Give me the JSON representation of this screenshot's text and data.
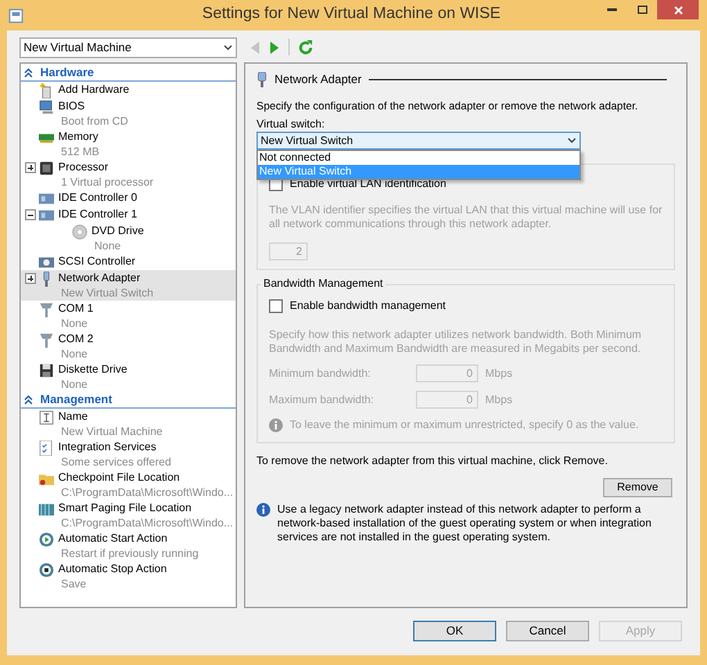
{
  "window": {
    "title": "Settings for New Virtual Machine on WISE"
  },
  "vm_selector": {
    "value": "New Virtual Machine"
  },
  "toolbar": {
    "back": {
      "disabled": true
    },
    "forward": {
      "disabled": false
    }
  },
  "tree": [
    {
      "heading": "Hardware",
      "expanded": true,
      "items": [
        {
          "label": "Add Hardware",
          "selected": false
        },
        {
          "label": "BIOS",
          "detail": "Boot from CD",
          "selected": false
        },
        {
          "label": "Memory",
          "detail": "512 MB",
          "selected": false
        },
        {
          "label": "Processor",
          "detail": "1 Virtual processor",
          "expanded": false,
          "selected": false
        },
        {
          "label": "IDE Controller 0",
          "selected": false
        },
        {
          "label": "IDE Controller 1",
          "expanded": true,
          "selected": false,
          "children": [
            {
              "label": "DVD Drive",
              "detail": "None",
              "selected": false
            }
          ]
        },
        {
          "label": "SCSI Controller",
          "selected": false
        },
        {
          "label": "Network Adapter",
          "detail": "New Virtual Switch",
          "expanded": false,
          "selected": true
        },
        {
          "label": "COM 1",
          "detail": "None",
          "selected": false
        },
        {
          "label": "COM 2",
          "detail": "None",
          "selected": false
        },
        {
          "label": "Diskette Drive",
          "detail": "None",
          "selected": false
        }
      ]
    },
    {
      "heading": "Management",
      "expanded": true,
      "items": [
        {
          "label": "Name",
          "detail": "New Virtual Machine",
          "selected": false
        },
        {
          "label": "Integration Services",
          "detail": "Some services offered",
          "selected": false
        },
        {
          "label": "Checkpoint File Location",
          "detail": "C:\\ProgramData\\Microsoft\\Windo...",
          "selected": false
        },
        {
          "label": "Smart Paging File Location",
          "detail": "C:\\ProgramData\\Microsoft\\Windo...",
          "selected": false
        },
        {
          "label": "Automatic Start Action",
          "detail": "Restart if previously running",
          "selected": false
        },
        {
          "label": "Automatic Stop Action",
          "detail": "Save",
          "selected": false
        }
      ]
    }
  ],
  "panel": {
    "title": "Network Adapter",
    "description": "Specify the configuration of the network adapter or remove the network adapter.",
    "switch_label": "Virtual switch:",
    "switch": {
      "value": "New Virtual Switch",
      "open": true,
      "options": [
        {
          "label": "Not connected",
          "selected": false
        },
        {
          "label": "New Virtual Switch",
          "selected": true
        }
      ]
    },
    "vlan": {
      "checkbox": {
        "label": "Enable virtual LAN identification",
        "checked": false
      },
      "description": "The VLAN identifier specifies the virtual LAN that this virtual machine will use for all network communications through this network adapter.",
      "value": "2"
    },
    "bandwidth": {
      "title": "Bandwidth Management",
      "checkbox": {
        "label": "Enable bandwidth management",
        "checked": false
      },
      "description": "Specify how this network adapter utilizes network bandwidth. Both Minimum Bandwidth and Maximum Bandwidth are measured in Megabits per second.",
      "fields": [
        {
          "label": "Minimum bandwidth:",
          "value": "0",
          "unit": "Mbps"
        },
        {
          "label": "Maximum bandwidth:",
          "value": "0",
          "unit": "Mbps"
        }
      ],
      "note": "To leave the minimum or maximum unrestricted, specify 0 as the value."
    },
    "remove_text": "To remove the network adapter from this virtual machine, click Remove.",
    "remove_button": "Remove",
    "legacy_note": "Use a legacy network adapter instead of this network adapter to perform a network-based installation of the guest operating system or when integration services are not installed in the guest operating system."
  },
  "buttons": [
    {
      "label": "OK",
      "default": true,
      "disabled": false
    },
    {
      "label": "Cancel",
      "default": false,
      "disabled": false
    },
    {
      "label": "Apply",
      "default": false,
      "disabled": true
    }
  ]
}
